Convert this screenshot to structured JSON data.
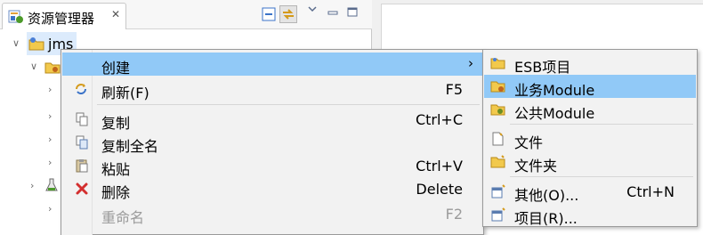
{
  "explorer": {
    "tab_title": "资源管理器",
    "tab_close": "✕",
    "toolbar_icons": [
      "collapse-all-icon",
      "link-with-editor-icon",
      "view-menu-icon",
      "minimize-icon",
      "maximize-icon"
    ]
  },
  "tree": {
    "root": {
      "label": "jms",
      "twisty": "∨"
    },
    "children_twisties": [
      "∨",
      "›",
      "›",
      "›",
      "›",
      "›",
      "›"
    ]
  },
  "context_menu": {
    "items": [
      {
        "label": "创建",
        "accel": "",
        "submenu_arrow": "›",
        "icon": ""
      },
      {
        "label": "刷新(F)",
        "accel": "F5",
        "icon": "refresh-icon"
      },
      {
        "label": "复制",
        "accel": "Ctrl+C",
        "icon": "copy-icon"
      },
      {
        "label": "复制全名",
        "accel": "",
        "icon": "copy-qualified-name-icon"
      },
      {
        "label": "粘贴",
        "accel": "Ctrl+V",
        "icon": "paste-icon"
      },
      {
        "label": "删除",
        "accel": "Delete",
        "icon": "delete-icon"
      },
      {
        "label": "重命名",
        "accel": "F2",
        "icon": ""
      }
    ]
  },
  "submenu": {
    "items": [
      {
        "label": "ESB项目",
        "accel": "",
        "icon": "folder-icon"
      },
      {
        "label": "业务Module",
        "accel": "",
        "icon": "business-module-icon"
      },
      {
        "label": "公共Module",
        "accel": "",
        "icon": "common-module-icon"
      },
      {
        "label": "文件",
        "accel": "",
        "icon": "file-icon"
      },
      {
        "label": "文件夹",
        "accel": "",
        "icon": "folder-icon"
      },
      {
        "label": "其他(O)...",
        "accel": "Ctrl+N",
        "icon": "other-wizard-icon"
      },
      {
        "label": "项目(R)...",
        "accel": "",
        "icon": "project-wizard-icon"
      }
    ]
  },
  "colors": {
    "highlight": "#91c9f7",
    "selection": "#dcebfc",
    "delete_red": "#d32f2f",
    "folder_yellow": "#f2c94c"
  }
}
